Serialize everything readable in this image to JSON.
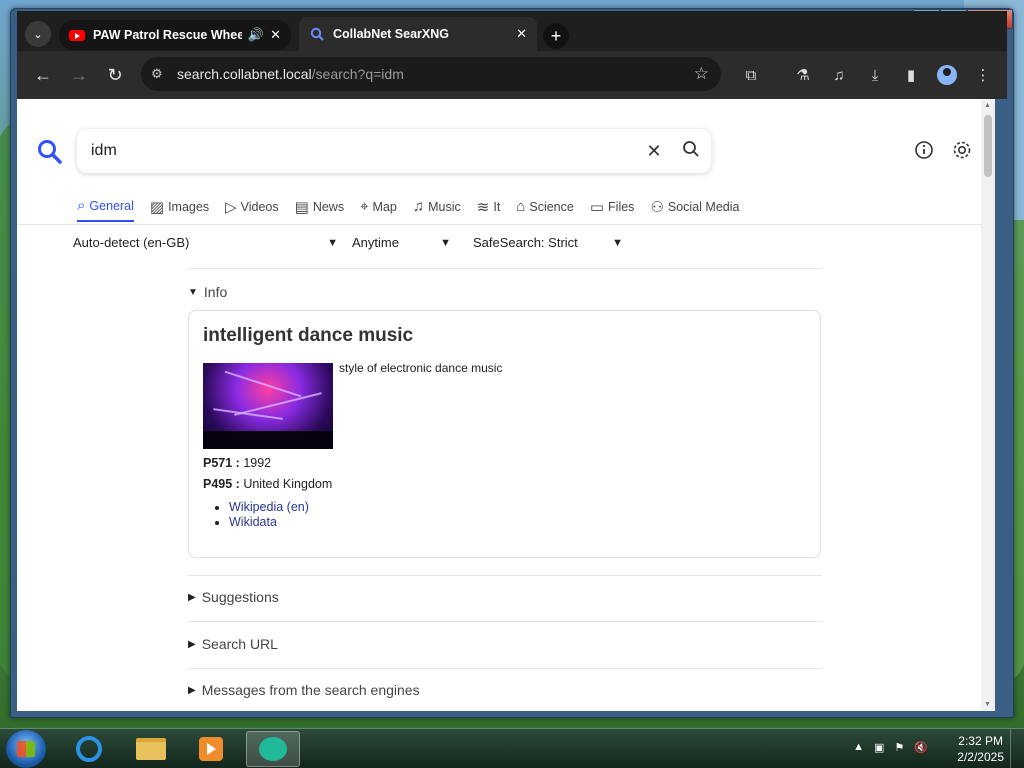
{
  "browser": {
    "tabs": [
      {
        "title": "PAW Patrol Rescue Wheels",
        "favicon": "youtube-icon",
        "audio_icon": "speaker-icon",
        "close_icon": "close-icon"
      },
      {
        "title": "CollabNet SearXNG",
        "favicon": "search-icon",
        "close_icon": "close-icon"
      }
    ],
    "new_tab_label": "+",
    "url_host": "search.collabnet.local",
    "url_path": "/search?q=idm"
  },
  "search": {
    "query": "idm",
    "categories": [
      {
        "label": "General",
        "icon": "search-icon"
      },
      {
        "label": "Images",
        "icon": "image-icon"
      },
      {
        "label": "Videos",
        "icon": "play-icon"
      },
      {
        "label": "News",
        "icon": "newspaper-icon"
      },
      {
        "label": "Map",
        "icon": "map-pin-icon"
      },
      {
        "label": "Music",
        "icon": "music-icon"
      },
      {
        "label": "It",
        "icon": "layers-icon"
      },
      {
        "label": "Science",
        "icon": "graduation-cap-icon"
      },
      {
        "label": "Files",
        "icon": "files-icon"
      },
      {
        "label": "Social Media",
        "icon": "people-icon"
      }
    ],
    "filters": {
      "language": "Auto-detect (en-GB)",
      "time": "Anytime",
      "safesearch": "SafeSearch: Strict"
    }
  },
  "info": {
    "section_label": "Info",
    "title": "intelligent dance music",
    "description": "style of electronic dance music",
    "attributes": [
      {
        "key": "P571 :",
        "value": "1992"
      },
      {
        "key": "P495 :",
        "value": "United Kingdom"
      }
    ],
    "links": [
      "Wikipedia (en)",
      "Wikidata"
    ]
  },
  "sections": {
    "suggestions": "Suggestions",
    "search_url": "Search URL",
    "messages": "Messages from the search engines"
  },
  "taskbar": {
    "time": "2:32 PM",
    "date": "2/2/2025"
  },
  "colors": {
    "accent": "#3050ff",
    "link": "#2a3596"
  }
}
